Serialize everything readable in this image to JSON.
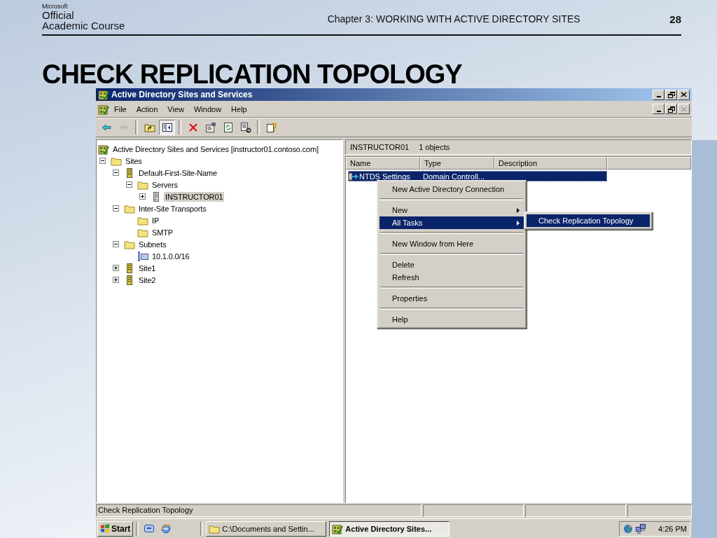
{
  "slide": {
    "logo": {
      "brand": "Microsoft",
      "lines": [
        "Official",
        "Academic Course"
      ]
    },
    "chapter": "Chapter 3: WORKING WITH ACTIVE DIRECTORY SITES",
    "page": "28",
    "title": "CHECK REPLICATION TOPOLOGY"
  },
  "window": {
    "title": "Active Directory Sites and Services",
    "mdi_controls": [
      {
        "kind": "minimize",
        "disabled": false
      },
      {
        "kind": "restore",
        "disabled": false
      },
      {
        "kind": "close",
        "disabled": true
      }
    ]
  },
  "menu_bar": [
    "File",
    "Action",
    "View",
    "Window",
    "Help"
  ],
  "toolbar": [
    {
      "kind": "back",
      "disabled": false,
      "pressed": false
    },
    {
      "kind": "forward",
      "disabled": true,
      "pressed": false
    },
    {
      "kind": "separator"
    },
    {
      "kind": "up",
      "disabled": false,
      "pressed": false
    },
    {
      "kind": "tree",
      "disabled": false,
      "pressed": true
    },
    {
      "kind": "separator"
    },
    {
      "kind": "delete",
      "disabled": false,
      "pressed": false
    },
    {
      "kind": "properties",
      "disabled": false,
      "pressed": false
    },
    {
      "kind": "refresh",
      "disabled": false,
      "pressed": false
    },
    {
      "kind": "export",
      "disabled": false,
      "pressed": false
    },
    {
      "kind": "separator"
    },
    {
      "kind": "help",
      "disabled": false,
      "pressed": false
    }
  ],
  "tree": {
    "label": "Active Directory Sites and Services [instructor01.contoso.com]",
    "kind": "root",
    "selected": false,
    "children": [
      {
        "label": "Sites",
        "kind": "folder",
        "expanded": true,
        "selected": false,
        "children": [
          {
            "label": "Default-First-Site-Name",
            "kind": "site",
            "expanded": true,
            "selected": false,
            "children": [
              {
                "label": "Servers",
                "kind": "folder",
                "expanded": true,
                "selected": false,
                "children": [
                  {
                    "label": "INSTRUCTOR01",
                    "kind": "server",
                    "expanded": false,
                    "selected": true
                  }
                ]
              }
            ]
          },
          {
            "label": "Inter-Site Transports",
            "kind": "folder",
            "expanded": true,
            "selected": false,
            "children": [
              {
                "label": "IP",
                "kind": "folder",
                "selected": false
              },
              {
                "label": "SMTP",
                "kind": "folder",
                "selected": false
              }
            ]
          },
          {
            "label": "Subnets",
            "kind": "folder",
            "expanded": true,
            "selected": false,
            "children": [
              {
                "label": "10.1.0.0/16",
                "kind": "subnet",
                "selected": false
              }
            ]
          },
          {
            "label": "Site1",
            "kind": "site",
            "expanded": false,
            "selected": false
          },
          {
            "label": "Site2",
            "kind": "site",
            "expanded": false,
            "selected": false
          }
        ]
      }
    ]
  },
  "details": {
    "title": "INSTRUCTOR01",
    "count": "1 objects",
    "columns": [
      "Name",
      "Type",
      "Description"
    ],
    "rows": [
      {
        "name": "NTDS Settings",
        "type": "Domain Controll...",
        "selected": true
      }
    ]
  },
  "context_menu": {
    "items": [
      {
        "kind": "item",
        "label": "New Active Directory Connection",
        "submenu": false,
        "selected": false
      },
      {
        "kind": "separator"
      },
      {
        "kind": "item",
        "label": "New",
        "submenu": true,
        "selected": false
      },
      {
        "kind": "item",
        "label": "All Tasks",
        "submenu": true,
        "selected": true
      },
      {
        "kind": "separator"
      },
      {
        "kind": "item",
        "label": "New Window from Here",
        "submenu": false,
        "selected": false
      },
      {
        "kind": "separator"
      },
      {
        "kind": "item",
        "label": "Delete",
        "submenu": false,
        "selected": false
      },
      {
        "kind": "item",
        "label": "Refresh",
        "submenu": false,
        "selected": false
      },
      {
        "kind": "separator"
      },
      {
        "kind": "item",
        "label": "Properties",
        "submenu": false,
        "selected": false
      },
      {
        "kind": "separator"
      },
      {
        "kind": "item",
        "label": "Help",
        "submenu": false,
        "selected": false
      }
    ],
    "submenu": [
      {
        "label": "Check Replication Topology",
        "selected": true
      }
    ]
  },
  "status_bar": {
    "text": "Check Replication Topology"
  },
  "taskbar": {
    "start": "Start",
    "tasks": [
      {
        "label": "C:\\Documents and Settin...",
        "kind": "folder",
        "selected": false
      },
      {
        "label": "Active Directory Sites...",
        "kind": "app",
        "selected": true
      }
    ],
    "clock": "4:26 PM"
  }
}
